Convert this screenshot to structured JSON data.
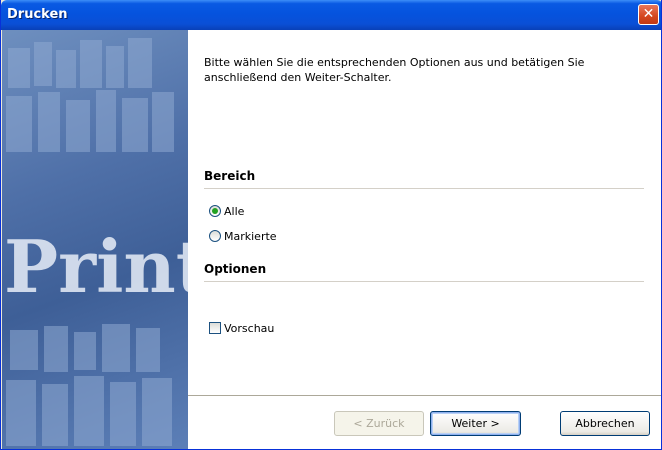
{
  "window": {
    "title": "Drucken",
    "close_symbol": "✕"
  },
  "side_image": {
    "icon": "print-letterpress-banner",
    "text": "Print"
  },
  "instruction": "Bitte wählen Sie die entsprechenden Optionen aus und betätigen Sie anschließend den Weiter-Schalter.",
  "bereich": {
    "title": "Bereich",
    "options": [
      {
        "label": "Alle",
        "checked": true
      },
      {
        "label": "Markierte",
        "checked": false
      }
    ]
  },
  "optionen": {
    "title": "Optionen",
    "preview_label": "Vorschau",
    "preview_checked": false
  },
  "buttons": {
    "back": "< Zurück",
    "next": "Weiter >",
    "cancel": "Abbrechen"
  }
}
